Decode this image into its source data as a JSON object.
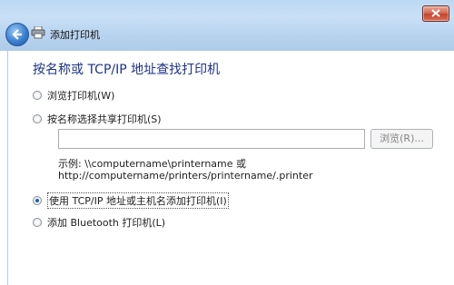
{
  "window": {
    "title": "添加打印机",
    "close_icon": "close-icon",
    "back_icon": "back-arrow-icon",
    "app_icon": "printer-icon"
  },
  "main": {
    "heading": "按名称或 TCP/IP 地址查找打印机",
    "options": [
      {
        "label": "浏览打印机(W)",
        "checked": false
      },
      {
        "label": "按名称选择共享打印机(S)",
        "checked": false
      },
      {
        "label": "使用 TCP/IP 地址或主机名添加打印机(I)",
        "checked": true
      },
      {
        "label": "添加 Bluetooth 打印机(L)",
        "checked": false
      }
    ],
    "share_input": {
      "value": "",
      "placeholder": ""
    },
    "browse_label": "浏览(R)...",
    "example_line1": "示例: \\\\computername\\printername 或",
    "example_line2": "http://computername/printers/printername/.printer"
  },
  "colors": {
    "heading": "#1e3287",
    "chrome": "#bcd8f3",
    "close": "#c4432b"
  }
}
